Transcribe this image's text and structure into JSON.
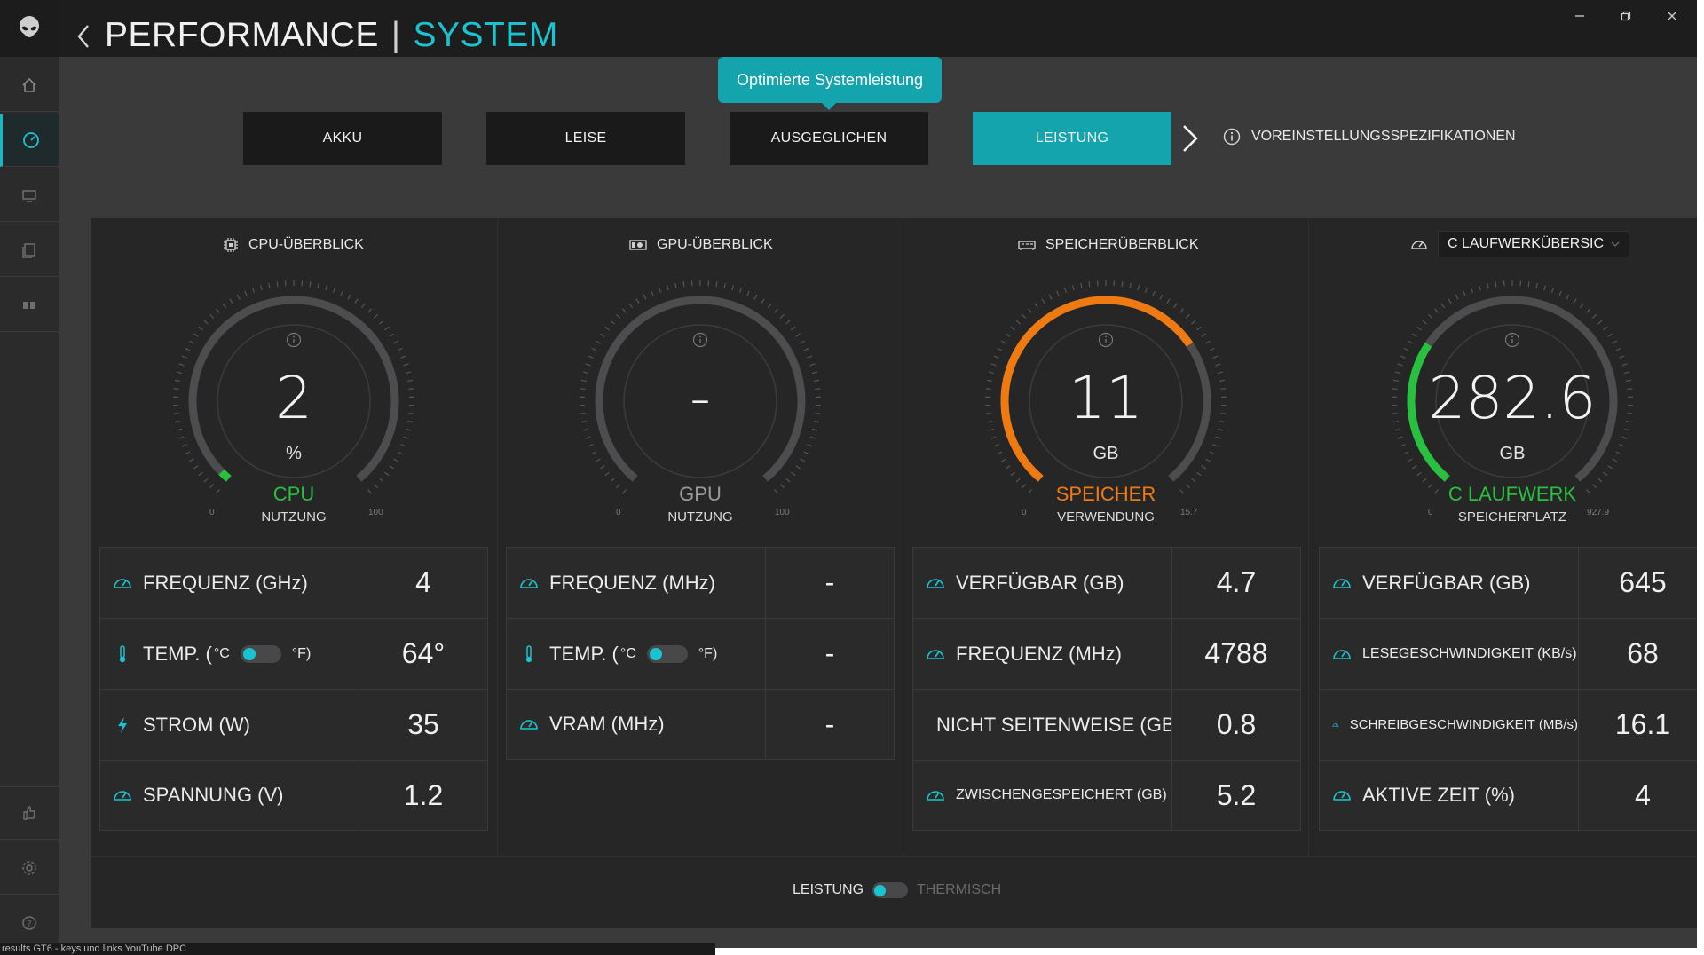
{
  "header": {
    "title": "PERFORMANCE",
    "separator": "|",
    "subtitle": "SYSTEM"
  },
  "presets": {
    "tooltip": "Optimierte Systemleistung",
    "items": [
      "AKKU",
      "LEISE",
      "AUSGEGLICHEN",
      "LEISTUNG"
    ],
    "active": "LEISTUNG",
    "specs_label": "VOREINSTELLUNGSSPEZIFIKATIONEN"
  },
  "sections": {
    "cpu": {
      "header": "CPU-ÜBERBLICK",
      "gauge": {
        "value": "2",
        "unit": "%",
        "name": "CPU",
        "sub": "NUTZUNG",
        "min": "0",
        "max": "100",
        "fraction": 0.02,
        "color": "#27c13f"
      },
      "rows": [
        {
          "label": "FREQUENZ (GHz)",
          "value": "4"
        },
        {
          "label": "TEMP. (",
          "unit_c": "°C",
          "unit_f": "°F)",
          "value": "64°"
        },
        {
          "label": "STROM (W)",
          "value": "35"
        },
        {
          "label": "SPANNUNG (V)",
          "value": "1.2"
        }
      ]
    },
    "gpu": {
      "header": "GPU-ÜBERBLICK",
      "gauge": {
        "value": "-",
        "unit": "",
        "name": "GPU",
        "sub": "NUTZUNG",
        "min": "0",
        "max": "100",
        "fraction": 0,
        "color": "#9a9a9a"
      },
      "rows": [
        {
          "label": "FREQUENZ (MHz)",
          "value": "-"
        },
        {
          "label": "TEMP. (",
          "unit_c": "°C",
          "unit_f": "°F)",
          "value": "-"
        },
        {
          "label": "VRAM (MHz)",
          "value": "-"
        }
      ]
    },
    "memory": {
      "header": "SPEICHERÜBERBLICK",
      "gauge": {
        "value": "11",
        "unit": "GB",
        "name": "SPEICHER",
        "sub": "VERWENDUNG",
        "min": "0",
        "max": "15.7",
        "fraction": 0.7,
        "color": "#f07a12"
      },
      "rows": [
        {
          "label": "VERFÜGBAR (GB)",
          "value": "4.7"
        },
        {
          "label": "FREQUENZ (MHz)",
          "value": "4788"
        },
        {
          "label": "NICHT SEITENWEISE (GB)",
          "value": "0.8"
        },
        {
          "label": "ZWISCHENGESPEICHERT (GB)",
          "value": "5.2"
        }
      ]
    },
    "drive": {
      "header": "C LAUFWERKÜBERSIC",
      "gauge": {
        "value": "282.6",
        "unit": "GB",
        "name": "C LAUFWERK",
        "sub": "SPEICHERPLATZ",
        "min": "0",
        "max": "927.9",
        "fraction": 0.3,
        "color": "#27c13f"
      },
      "rows": [
        {
          "label": "VERFÜGBAR (GB)",
          "value": "645"
        },
        {
          "label": "LESEGESCHWINDIGKEIT (KB/s)",
          "value": "68"
        },
        {
          "label": "SCHREIBGESCHWINDIGKEIT (MB/s)",
          "value": "16.1"
        },
        {
          "label": "AKTIVE ZEIT (%)",
          "value": "4"
        }
      ]
    }
  },
  "footer": {
    "left": "LEISTUNG",
    "right": "THERMISCH"
  },
  "taskbar": {
    "text": "results GT6 - keys und links YouTube DPC"
  },
  "colors": {
    "accent": "#19c3cf",
    "active_preset": "#13a4ae",
    "cpu_green": "#27c13f",
    "memory_orange": "#f07a12"
  },
  "icons": {
    "sidebar": [
      "alien-logo-icon",
      "home-icon",
      "performance-gauge-icon",
      "monitor-icon",
      "library-icon",
      "gamepad-icon",
      "thumbs-up-icon",
      "settings-icon",
      "help-icon"
    ],
    "rows": [
      "gauge-icon",
      "thermometer-icon",
      "lightning-icon"
    ]
  }
}
